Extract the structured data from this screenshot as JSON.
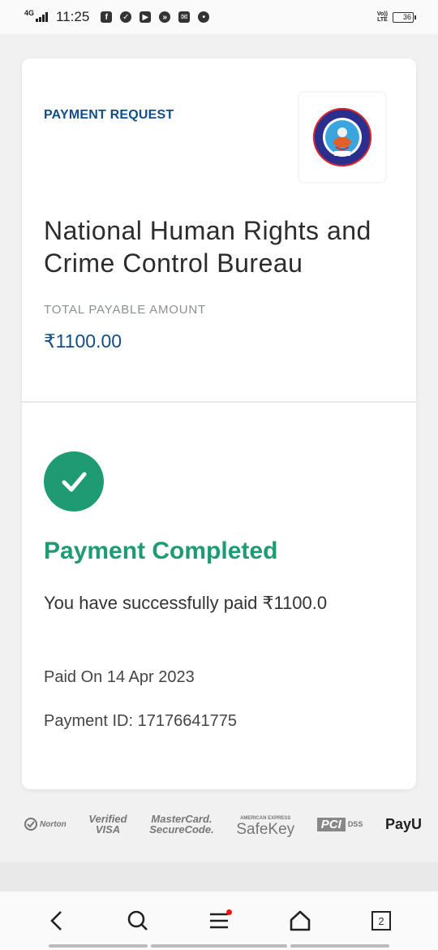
{
  "status_bar": {
    "network": "4G",
    "time": "11:25",
    "volte": "VoLTE",
    "battery": "36"
  },
  "payment_card": {
    "request_label": "PAYMENT REQUEST",
    "merchant_name": "National Human Rights and Crime Control Bureau",
    "logo_text": "NHRCCB",
    "payable_label": "TOTAL PAYABLE AMOUNT",
    "payable_amount": "₹1100.00"
  },
  "status_card": {
    "title": "Payment Completed",
    "message": "You have successfully paid ₹1100.0",
    "paid_on": "Paid On 14 Apr 2023",
    "payment_id": "Payment ID: 17176641775"
  },
  "trust_badges": {
    "norton": "Norton",
    "verified_visa_line1": "Verified",
    "verified_visa_line2": "VISA",
    "mastercard_line1": "MasterCard.",
    "mastercard_line2": "SecureCode.",
    "safekey_small": "AMERICAN EXPRESS",
    "safekey": "SafeKey",
    "pci": "PCI",
    "dss": "DSS",
    "payu": "PayU"
  },
  "navbar": {
    "tabs_count": "2"
  },
  "colors": {
    "accent_blue": "#124e8a",
    "success_green": "#1f9b74"
  }
}
